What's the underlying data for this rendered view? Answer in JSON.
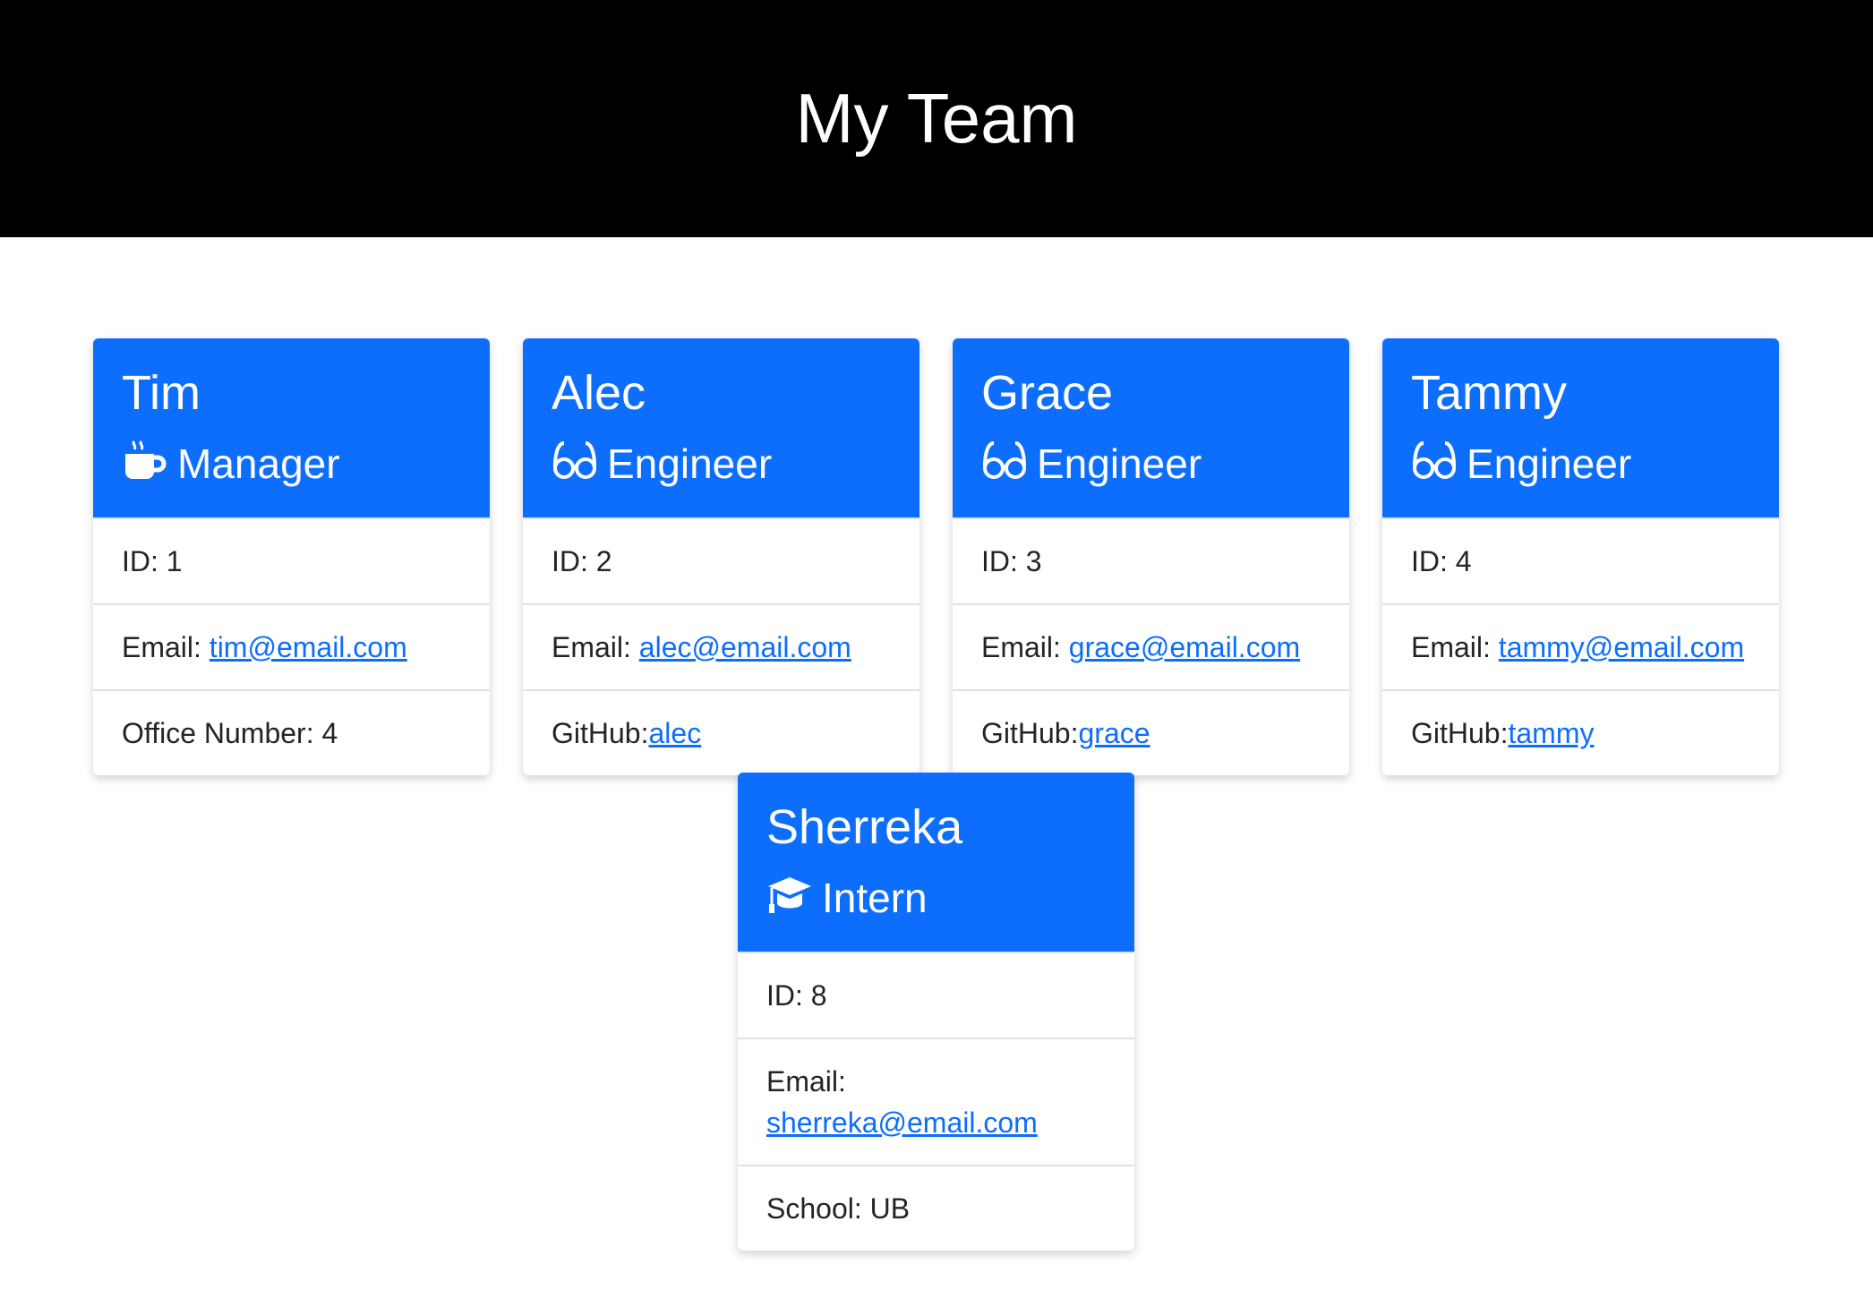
{
  "header": {
    "title": "My Team"
  },
  "employees": [
    {
      "name": "Tim",
      "role": "Manager",
      "icon": "mug-hot-icon",
      "id_label": "ID: 1",
      "email_label": "Email: ",
      "email": "tim@email.com",
      "extra_label": "Office Number: 4",
      "extra_link": ""
    },
    {
      "name": "Alec",
      "role": "Engineer",
      "icon": "glasses-icon",
      "id_label": "ID: 2",
      "email_label": "Email: ",
      "email": "alec@email.com",
      "extra_label": "GitHub:",
      "extra_link": "alec"
    },
    {
      "name": "Grace",
      "role": "Engineer",
      "icon": "glasses-icon",
      "id_label": "ID: 3",
      "email_label": "Email: ",
      "email": "grace@email.com",
      "extra_label": "GitHub:",
      "extra_link": "grace"
    },
    {
      "name": "Tammy",
      "role": "Engineer",
      "icon": "glasses-icon",
      "id_label": "ID: 4",
      "email_label": "Email: ",
      "email": "tammy@email.com",
      "extra_label": "GitHub:",
      "extra_link": "tammy"
    },
    {
      "name": "Sherreka",
      "role": "Intern",
      "icon": "graduation-cap-icon",
      "id_label": "ID: 8",
      "email_label": "Email: ",
      "email": "sherreka@email.com",
      "extra_label": "School: UB",
      "extra_link": ""
    }
  ],
  "colors": {
    "primary": "#0d6efd",
    "header_bg": "#000000"
  }
}
